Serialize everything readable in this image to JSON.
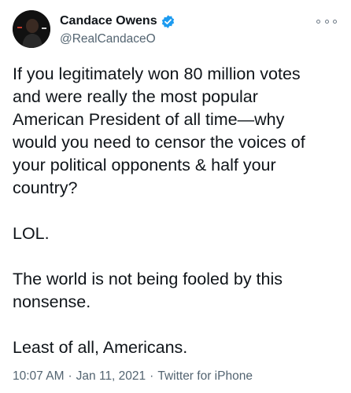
{
  "author": {
    "display_name": "Candace Owens",
    "handle": "@RealCandaceO",
    "verified": true,
    "avatar_icon": "profile-photo"
  },
  "tweet": {
    "paragraphs": [
      "If you legitimately won 80 million votes\nand were really the most popular\nAmerican President of all time—why\nwould you need to censor the voices of\nyour political opponents & half your\ncountry?",
      "LOL.",
      "The world is not being fooled by this\nnonsense.",
      "Least of all, Americans."
    ]
  },
  "meta": {
    "time": "10:07 AM",
    "separator": "·",
    "date": "Jan 11, 2021",
    "source": "Twitter for iPhone"
  },
  "icons": {
    "verified": "verified-badge-icon",
    "more": "more-options-icon"
  },
  "colors": {
    "verified_blue": "#1d9bf0",
    "secondary_text": "#536471",
    "primary_text": "#0f1419"
  }
}
